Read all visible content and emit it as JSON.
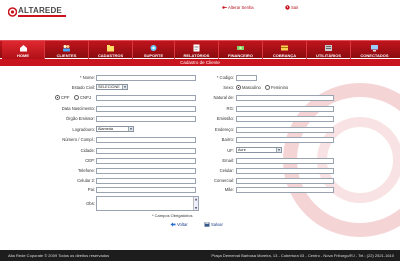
{
  "brand": {
    "name": "ALTAREDE",
    "accent": "#c8141e"
  },
  "top_links": {
    "change_password": "Alterar Senha",
    "logout": "Sair"
  },
  "nav": {
    "items": [
      {
        "label": "HOME",
        "icon": "home-icon"
      },
      {
        "label": "CLIENTES",
        "icon": "users-icon"
      },
      {
        "label": "CADASTROS",
        "icon": "folder-icon"
      },
      {
        "label": "SUPORTE",
        "icon": "support-icon"
      },
      {
        "label": "RELATÓRIOS",
        "icon": "report-icon"
      },
      {
        "label": "FINANCEIRO",
        "icon": "money-icon"
      },
      {
        "label": "COBRANÇA",
        "icon": "billing-icon"
      },
      {
        "label": "UTILITÁRIOS",
        "icon": "tools-icon"
      },
      {
        "label": "CONECTADOS",
        "icon": "connected-icon"
      }
    ]
  },
  "section_title": "Cadastro de Cliente",
  "form": {
    "left": {
      "nome": "* Nome:",
      "estado_civil": "Estado Civil:",
      "estado_civil_value": "SELECIONE",
      "cpf": "CPF",
      "cnpj": "CNPJ",
      "nascimento": "Data Nascimento:",
      "orgao": "Órgão Emissor:",
      "logradouro": "Logradouro:",
      "logradouro_value": "Alameda",
      "numero": "Número / Compl.:",
      "cidade": "Cidade:",
      "cep": "CEP:",
      "telefone": "Telefone:",
      "celular2": "Celular 2:",
      "pai": "Pai:",
      "obs": "Obs:"
    },
    "right": {
      "codigo": "* Codigo:",
      "sexo": "Sexo:",
      "masculino": "Masculino",
      "feminino": "Feminino",
      "natural": "Natural de:",
      "rg": "RG:",
      "emissao": "Emissão:",
      "endereco": "Endereço:",
      "bairro": "Bairro:",
      "uf": "UF:",
      "uf_value": "Acre",
      "email": "Email:",
      "celular": "Celular:",
      "comercial": "Comercial:",
      "mae": "Mãe:"
    },
    "required_note": "* Campos Obrigatórios",
    "back": "Voltar",
    "save": "Salvar"
  },
  "footer": {
    "left": "Alta Rede Coporate © 2009  Todos os direitos reservados",
    "right": "Praça Demerval Barbosa Moreira, 13 - Cobertura 03 - Centro - Nova Friburgo/RJ - Tel.: (22) 2521-1610"
  }
}
